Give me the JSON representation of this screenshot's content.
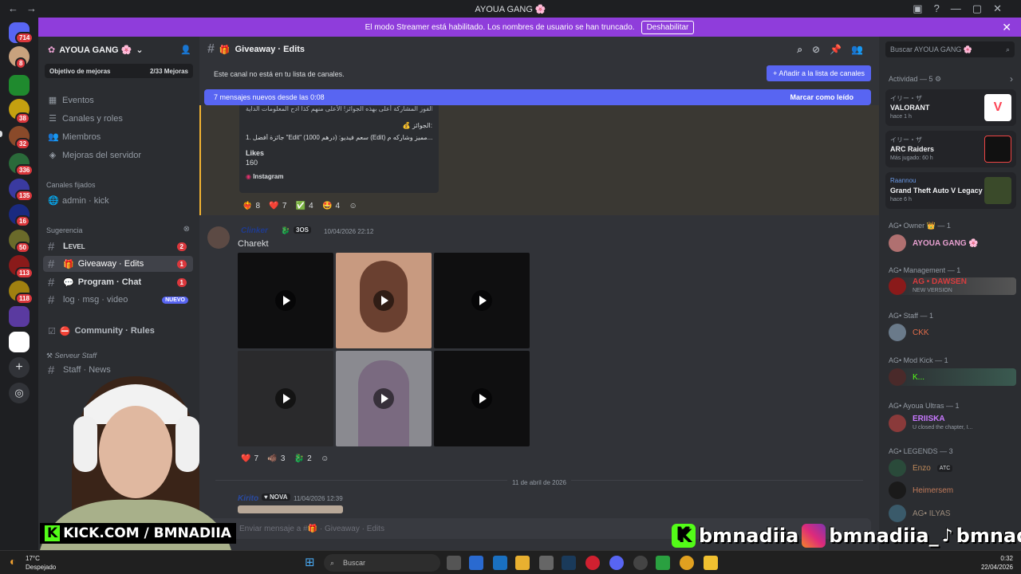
{
  "window": {
    "title": "AYOUA GANG 🌸"
  },
  "banner": {
    "text": "El modo Streamer está habilitado. Los nombres de usuario se han truncado.",
    "button": "Deshabilitar"
  },
  "guild_badges": [
    "714",
    "8",
    "38",
    "32",
    "336",
    "135",
    "16",
    "50",
    "113",
    "118"
  ],
  "server": {
    "name": "AYOUA GANG 🌸",
    "boost_label": "Objetivo de mejoras",
    "boost_value": "2/33 Mejoras",
    "items": [
      "Eventos",
      "Canales y roles",
      "Miembros",
      "Mejoras del servidor"
    ],
    "pinned_header": "Canales fijados",
    "pinned_channel": "admin · kick",
    "suggest_header": "Sugerencia",
    "channels": [
      {
        "name": "Level",
        "count": "2"
      },
      {
        "name": "Giveaway · Edits",
        "count": "1"
      },
      {
        "name": "Program · Chat",
        "count": "1"
      },
      {
        "name": "log · msg · video",
        "badge": "NUEVO"
      },
      {
        "name": "Community · Rules"
      }
    ],
    "staff_category": "Serveur Staff",
    "staff_channel": "Staff · News"
  },
  "channel": {
    "name": "Giveaway · Edits",
    "notlisted": "Este canal no está en tu lista de canales.",
    "add_button": "Añadir a la lista de canales",
    "newmsg": "7 mensajes nuevos desde las 0:08",
    "mark_read": "Marcar como leído",
    "composer_placeholder": "Enviar mensaje a #🎁 · Giveaway · Edits"
  },
  "embed": {
    "line1": "على الفوز المشاركة أعلى بهذه الجوائز! الأعلى منهم كذا ادح المعلومات الداية",
    "prize_header": "💰 الجوائز:",
    "prize_line": "1. جائزة أفضل \"Edit\" (1000 درهم) :سعم فيديو (Edit) مميز وشاركه م...",
    "likes_label": "Likes",
    "likes_value": "160",
    "source": "Instagram"
  },
  "reactions1": [
    {
      "e": "❤️‍🔥",
      "n": "8"
    },
    {
      "e": "❤️",
      "n": "7"
    },
    {
      "e": "✅",
      "n": "4"
    },
    {
      "e": "🤩",
      "n": "4"
    }
  ],
  "message2": {
    "author": "Clinker",
    "tag": "3OS",
    "time": "10/04/2026 22:12",
    "text": "Charekt"
  },
  "reactions2": [
    {
      "e": "❤️",
      "n": "7"
    },
    {
      "e": "🐗",
      "n": "3"
    },
    {
      "e": "🐉",
      "n": "2"
    }
  ],
  "date_divider": "11 de abril de 2026",
  "message3": {
    "author": "Kirito",
    "tag": "NOVA",
    "time": "11/04/2026 12:39"
  },
  "members": {
    "search": "Buscar AYOUA GANG 🌸",
    "activity_header": "Actividad — 5",
    "activities": [
      {
        "user": "イリー・ザ",
        "game": "VALORANT",
        "meta": "hace 1 h"
      },
      {
        "user": "イリー・ザ",
        "game": "ARC Raiders",
        "meta": "Más jugado: 60 h"
      },
      {
        "user": "Raannou",
        "game": "Grand Theft Auto V Legacy",
        "meta": "hace 6 h"
      }
    ],
    "groups": [
      {
        "header": "AG• Owner 👑 — 1",
        "name": "AYOUA GANG 🌸",
        "color": "#e8a0d0"
      },
      {
        "header": "AG• Management — 1",
        "name": "AG • DAWSEN",
        "sub": "NEW VERSION",
        "color": "#d83c3e"
      },
      {
        "header": "AG• Staff — 1",
        "name": "CKK",
        "color": "#e06c4a"
      },
      {
        "header": "AG• Mod Kick — 1",
        "name": "K...",
        "color": "#53fc18"
      },
      {
        "header": "AG• Ayoua Ultras — 1",
        "name": "ERIISKA",
        "sub": "U closed the chapter, I...",
        "color": "#c878ff"
      },
      {
        "header": "AG• LEGENDS — 3",
        "name": "Enzo",
        "sub": "ATC",
        "color": "#c08a5a"
      },
      {
        "header": "",
        "name": "Heimersem",
        "color": "#c07a5a"
      },
      {
        "header": "",
        "name": "AG• ILYAS",
        "color": "#9a8a7a"
      }
    ]
  },
  "taskbar": {
    "temp": "17°C",
    "weather": "Despejado",
    "search": "Buscar",
    "time": "0:32",
    "date": "22/04/2026"
  },
  "overlay": {
    "kick": "KICK.COM / BMNADIIA",
    "k": "K",
    "kick_handle": "bmnadiia",
    "ig_handle": "bmnadiia_",
    "tt_handle": "bmnadiia"
  }
}
